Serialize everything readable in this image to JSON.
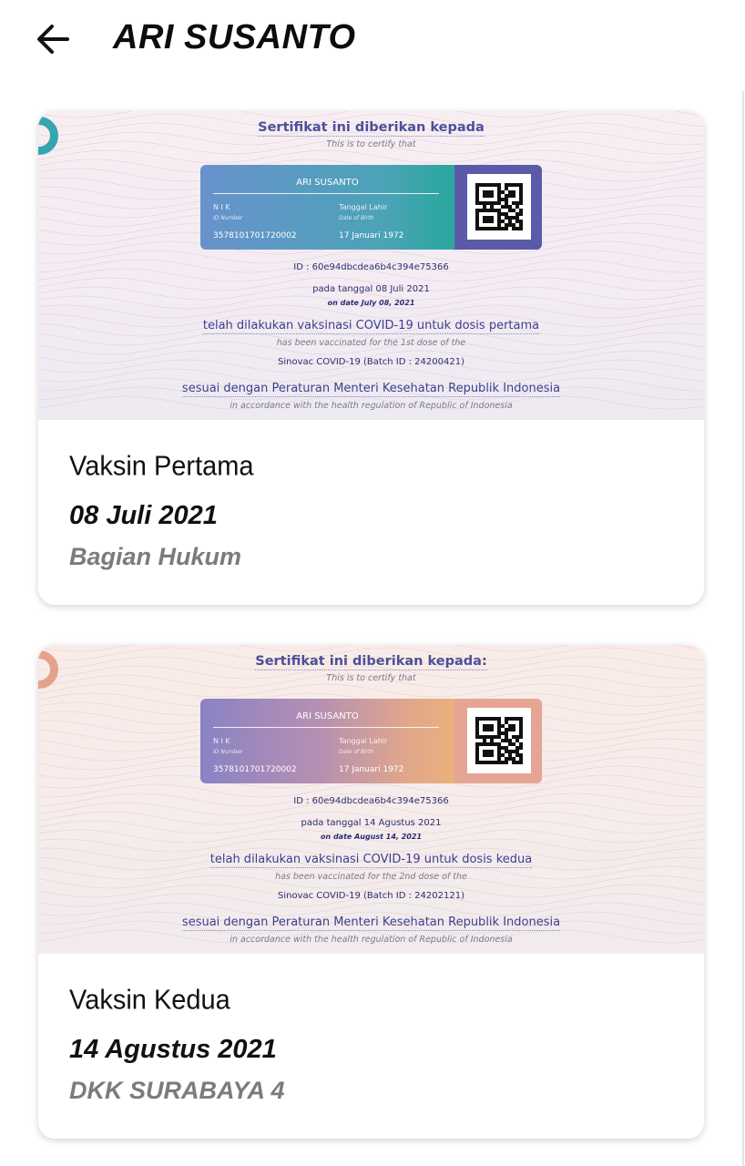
{
  "header": {
    "title": "ARI SUSANTO",
    "back_icon": "arrow-left-icon"
  },
  "certificates": [
    {
      "heading": "Sertifikat ini diberikan kepada",
      "heading_en": "This is to certify that",
      "name": "ARI SUSANTO",
      "nik_label": "N I K",
      "nik_label_en": "ID Number",
      "nik": "3578101701720002",
      "dob_label": "Tanggal Lahir",
      "dob_label_en": "Date of Birth",
      "dob": "17 Januari 1972",
      "cert_id": "ID : 60e94dbcdea6b4c394e75366",
      "date_line": "pada tanggal 08 Juli 2021",
      "date_line_en": "on date July 08, 2021",
      "vacc_line": "telah dilakukan vaksinasi COVID-19 untuk dosis pertama",
      "vacc_line_en": "has been vaccinated for the 1st dose of the",
      "vaccine": "Sinovac COVID-19 (Batch ID : 24200421)",
      "regulation": "sesuai dengan Peraturan Menteri Kesehatan Republik Indonesia",
      "regulation_en": "in accordance with the health regulation of Republic of Indonesia",
      "accent": "#2aa79f",
      "title": "Vaksin Pertama",
      "date": "08 Juli 2021",
      "place": "Bagian Hukum"
    },
    {
      "heading": "Sertifikat ini diberikan kepada:",
      "heading_en": "This is to certify that",
      "name": "ARI SUSANTO",
      "nik_label": "N I K",
      "nik_label_en": "ID Number",
      "nik": "3578101701720002",
      "dob_label": "Tanggal Lahir",
      "dob_label_en": "Date of Birth",
      "dob": "17 Januari 1972",
      "cert_id": "ID : 60e94dbcdea6b4c394e75366",
      "date_line": "pada tanggal 14 Agustus 2021",
      "date_line_en": "on date August 14, 2021",
      "vacc_line": "telah dilakukan vaksinasi COVID-19 untuk dosis kedua",
      "vacc_line_en": "has been vaccinated for the 2nd dose of the",
      "vaccine": "Sinovac COVID-19 (Batch ID : 24202121)",
      "regulation": "sesuai dengan Peraturan Menteri Kesehatan Republik Indonesia",
      "regulation_en": "in accordance with the health regulation of Republic of Indonesia",
      "accent": "#e6a494",
      "title": "Vaksin Kedua",
      "date": "14 Agustus 2021",
      "place": "DKK SURABAYA 4"
    }
  ]
}
